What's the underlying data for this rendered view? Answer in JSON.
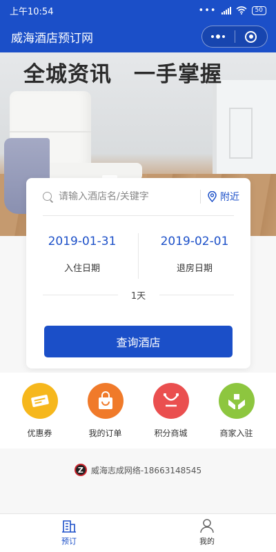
{
  "status_bar": {
    "time": "上午10:54",
    "battery": "50"
  },
  "nav": {
    "title": "威海酒店预订网"
  },
  "banner": {
    "headline": "全城资讯　一手掌握"
  },
  "search": {
    "placeholder": "请输入酒店名/关键字",
    "nearby_label": "附近"
  },
  "dates": {
    "checkin_value": "2019-01-31",
    "checkin_label": "入住日期",
    "checkout_value": "2019-02-01",
    "checkout_label": "退房日期",
    "nights": "1天"
  },
  "query_button": "查询酒店",
  "quick_menu": [
    {
      "label": "优惠券",
      "icon": "coupon-icon",
      "color": "#f6b71c"
    },
    {
      "label": "我的订单",
      "icon": "shopping-bag-icon",
      "color": "#f07a2a"
    },
    {
      "label": "积分商城",
      "icon": "cart-icon",
      "color": "#ea4f4f"
    },
    {
      "label": "商家入驻",
      "icon": "hands-box-icon",
      "color": "#8dc63f"
    }
  ],
  "credit": "威海志成网络-18663148545",
  "tabs": [
    {
      "label": "预订",
      "icon": "building-icon",
      "active": true
    },
    {
      "label": "我的",
      "icon": "person-icon",
      "active": false
    }
  ],
  "colors": {
    "primary": "#1b4fc8",
    "background": "#f7f7f7"
  }
}
